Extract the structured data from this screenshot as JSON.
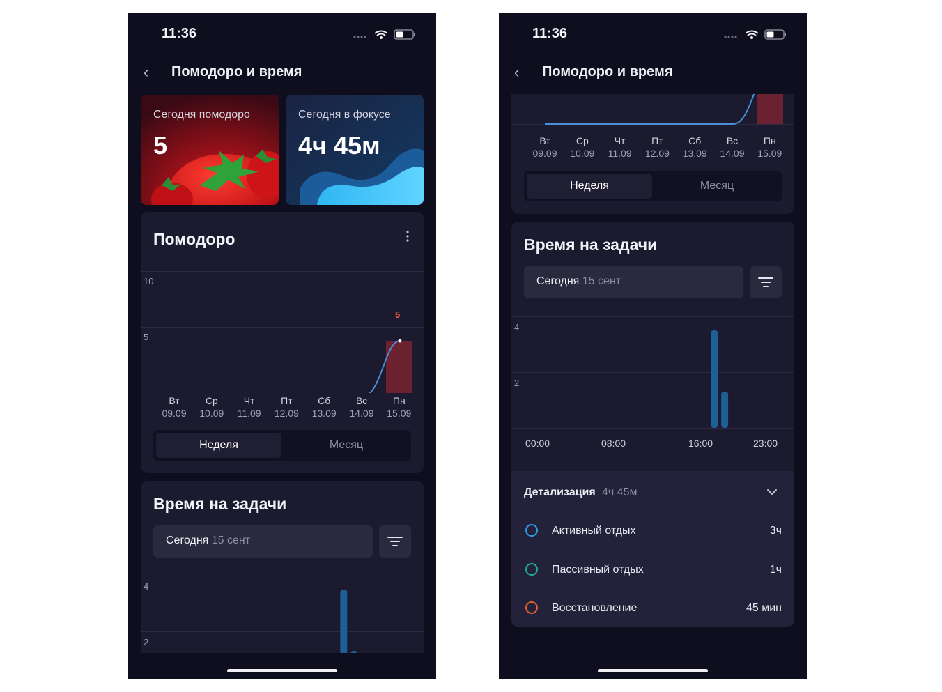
{
  "status": {
    "time": "11:36"
  },
  "nav": {
    "title": "Помодоро и время"
  },
  "stats": {
    "pomodoro": {
      "label": "Сегодня помодоро",
      "value": "5"
    },
    "focus": {
      "label": "Сегодня в фокусе",
      "value": "4ч 45м"
    }
  },
  "pomodoro_card": {
    "title": "Помодоро",
    "y_ticks": [
      "10",
      "5"
    ],
    "highlight_value": "5",
    "days": [
      {
        "day": "Вт",
        "date": "09.09"
      },
      {
        "day": "Ср",
        "date": "10.09"
      },
      {
        "day": "Чт",
        "date": "11.09"
      },
      {
        "day": "Пт",
        "date": "12.09"
      },
      {
        "day": "Сб",
        "date": "13.09"
      },
      {
        "day": "Вс",
        "date": "14.09"
      },
      {
        "day": "Пн",
        "date": "15.09"
      }
    ],
    "tabs": {
      "week": "Неделя",
      "month": "Месяц"
    }
  },
  "tasks_card": {
    "title": "Время на задачи",
    "date_main": "Сегодня",
    "date_sub": "15 сент",
    "y_ticks": [
      "4",
      "2"
    ],
    "hours": [
      "00:00",
      "08:00",
      "16:00",
      "23:00"
    ]
  },
  "details": {
    "label": "Детализация",
    "total": "4ч 45м",
    "items": [
      {
        "name": "Активный отдых",
        "time": "3ч",
        "color": "#2f9be0"
      },
      {
        "name": "Пассивный отдых",
        "time": "1ч",
        "color": "#1fae8f"
      },
      {
        "name": "Восстановление",
        "time": "45 мин",
        "color": "#e0602f"
      }
    ]
  },
  "chart_data": [
    {
      "type": "line",
      "title": "Помодоро",
      "categories": [
        "Вт 09.09",
        "Ср 10.09",
        "Чт 11.09",
        "Пт 12.09",
        "Сб 13.09",
        "Вс 14.09",
        "Пн 15.09"
      ],
      "values": [
        0,
        0,
        0,
        0,
        0,
        0,
        5
      ],
      "ylim": [
        0,
        10
      ],
      "grid": true
    },
    {
      "type": "bar",
      "title": "Время на задачи",
      "x_ticks": [
        "00:00",
        "08:00",
        "16:00",
        "23:00"
      ],
      "bars": [
        {
          "hour": 17,
          "value": 3.5
        },
        {
          "hour": 18,
          "value": 1.3
        }
      ],
      "ylim": [
        0,
        4
      ],
      "grid": true
    }
  ]
}
